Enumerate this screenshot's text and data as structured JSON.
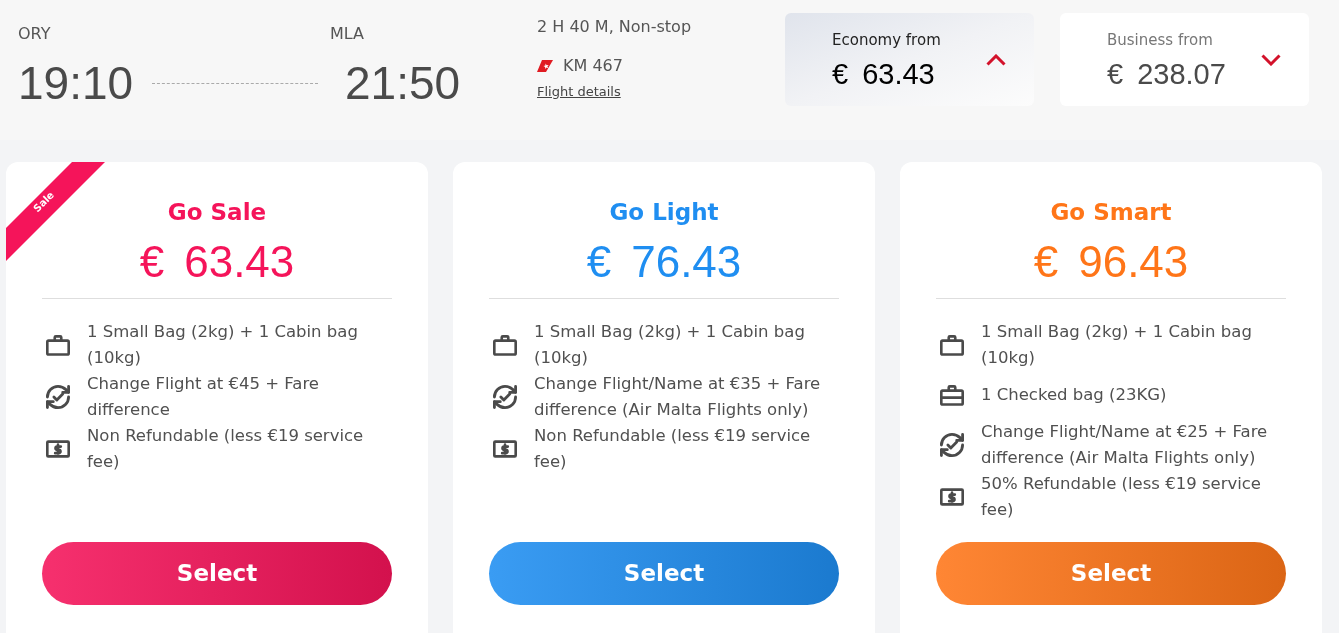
{
  "flight": {
    "departure": {
      "airport": "ORY",
      "time": "19:10"
    },
    "arrival": {
      "airport": "MLA",
      "time": "21:50"
    },
    "duration": "2 H 40 M, Non-stop",
    "flight_number": "KM 467",
    "details_link": "Flight details"
  },
  "cabins": [
    {
      "label": "Economy from",
      "currency": "€",
      "amount": "63.43",
      "selected": true
    },
    {
      "label": "Business from",
      "currency": "€",
      "amount": "238.07",
      "selected": false
    }
  ],
  "fares": [
    {
      "name": "Go Sale",
      "ribbon": "Sale",
      "color": "#f5145a",
      "currency": "€",
      "amount": "63.43",
      "features": [
        {
          "kind": "bag",
          "text": "1 Small Bag (2kg) + 1 Cabin bag (10kg)"
        },
        {
          "kind": "change",
          "text": "Change Flight at €45 + Fare difference"
        },
        {
          "kind": "refund",
          "text": "Non Refundable (less €19 service fee)"
        }
      ],
      "button": "Select"
    },
    {
      "name": "Go Light",
      "color": "#1f8ef1",
      "currency": "€",
      "amount": "76.43",
      "features": [
        {
          "kind": "bag",
          "text": "1 Small Bag (2kg) + 1 Cabin bag (10kg)"
        },
        {
          "kind": "change",
          "text": "Change Flight/Name at €35 + Fare difference (Air Malta Flights only)"
        },
        {
          "kind": "refund",
          "text": "Non Refundable (less €19 service fee)"
        }
      ],
      "button": "Select"
    },
    {
      "name": "Go Smart",
      "color": "#ff7518",
      "currency": "€",
      "amount": "96.43",
      "features": [
        {
          "kind": "bag",
          "text": "1 Small Bag (2kg) + 1 Cabin bag (10kg)"
        },
        {
          "kind": "checked-bag",
          "text": "1 Checked bag (23KG)"
        },
        {
          "kind": "change",
          "text": "Change Flight/Name at €25 + Fare difference (Air Malta Flights only)"
        },
        {
          "kind": "refund",
          "text": "50% Refundable (less €19 service fee)"
        }
      ],
      "button": "Select"
    }
  ]
}
